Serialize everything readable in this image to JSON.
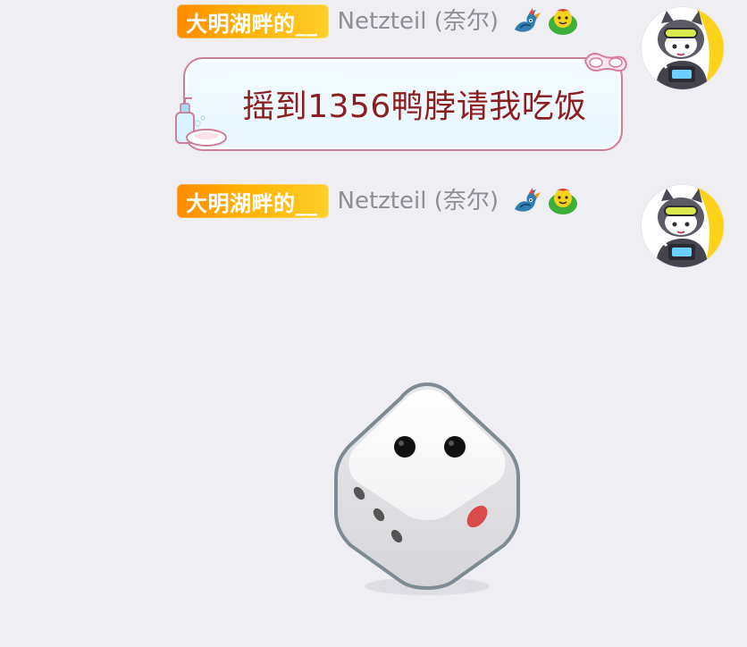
{
  "messages": [
    {
      "id": "m1",
      "title_badge": "大明湖畔的__",
      "nickname": "Netzteil (奈尔)",
      "text": "摇到1356鸭脖请我吃饭",
      "badge_icons": [
        "dragon-emblem-icon",
        "green-face-badge-icon"
      ],
      "avatar": "cat-avatar"
    },
    {
      "id": "m2",
      "title_badge": "大明湖畔的__",
      "nickname": "Netzteil (奈尔)",
      "dice_value": 2,
      "badge_icons": [
        "dragon-emblem-icon",
        "green-face-badge-icon"
      ],
      "avatar": "cat-avatar"
    }
  ],
  "colors": {
    "background": "#efeef3",
    "badge_gradient_start": "#ff8a00",
    "badge_gradient_end": "#ffcf2b",
    "nickname": "#8d8e96",
    "bubble_text": "#8b1e1e",
    "bubble_border": "#cc7d98",
    "bubble_fill": "#eef9ff"
  }
}
